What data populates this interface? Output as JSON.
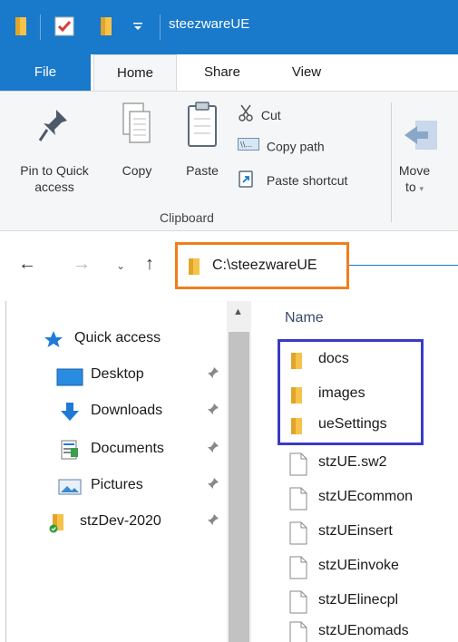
{
  "window": {
    "title": "steezwareUE",
    "accent_color": "#1979ca"
  },
  "ribbon_tabs": [
    {
      "label": "File"
    },
    {
      "label": "Home"
    },
    {
      "label": "Share"
    },
    {
      "label": "View"
    }
  ],
  "clipboard": {
    "pin_label_1": "Pin to Quick",
    "pin_label_2": "access",
    "copy_label": "Copy",
    "paste_label": "Paste",
    "cut_label": "Cut",
    "copy_path_label": "Copy path",
    "paste_shortcut_label": "Paste shortcut",
    "group_label": "Clipboard"
  },
  "organize": {
    "move_label_1": "Move",
    "move_label_2": "to"
  },
  "address_bar": {
    "path": "C:\\steezwareUE",
    "highlight_color": "#f07f1c"
  },
  "nav_pane": {
    "quick_access": "Quick access",
    "items": [
      {
        "label": "Desktop",
        "icon": "desktop-icon",
        "pinned": true
      },
      {
        "label": "Downloads",
        "icon": "downloads-icon",
        "pinned": true
      },
      {
        "label": "Documents",
        "icon": "documents-icon",
        "pinned": true
      },
      {
        "label": "Pictures",
        "icon": "pictures-icon",
        "pinned": true
      },
      {
        "label": "stzDev-2020",
        "icon": "synced-folder-icon",
        "pinned": true
      }
    ]
  },
  "file_list": {
    "column_header": "Name",
    "highlight_color": "#3a3ac8",
    "folders": [
      {
        "name": "docs"
      },
      {
        "name": "images"
      },
      {
        "name": "ueSettings"
      }
    ],
    "files": [
      {
        "name": "stzUE.sw2"
      },
      {
        "name": "stzUEcommon"
      },
      {
        "name": "stzUEinsert"
      },
      {
        "name": "stzUEinvoke"
      },
      {
        "name": "stzUElinecpl"
      },
      {
        "name": "stzUEnomads"
      }
    ]
  }
}
